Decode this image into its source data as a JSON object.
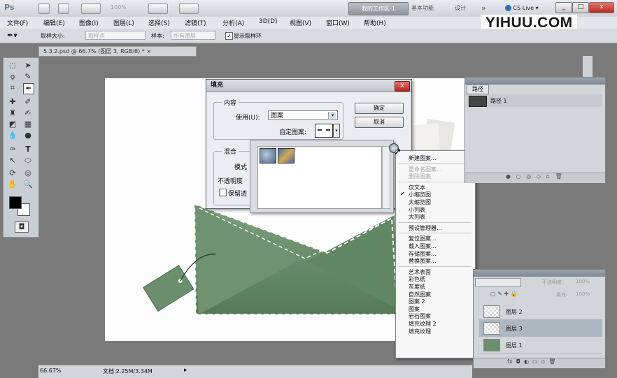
{
  "app": {
    "logo": "Ps",
    "zoom_label": "100%",
    "workspace_active": "我的工作区-1",
    "workspaces": [
      "基本功能",
      "设计"
    ],
    "more": "»",
    "cs_live": "CS Live",
    "window_buttons": [
      "_",
      "□",
      "x"
    ]
  },
  "menu": [
    "文件(F)",
    "编辑(E)",
    "图像(I)",
    "图层(L)",
    "选择(S)",
    "滤镜(T)",
    "分析(A)",
    "3D(D)",
    "视图(V)",
    "窗口(W)",
    "帮助(H)"
  ],
  "watermark": "YIHUU.COM",
  "options": {
    "sample_size_label": "取样大小:",
    "sample_size_value": "取样点",
    "sample_label": "样本:",
    "sample_value": "所有图层",
    "show_ring_label": "显示取样环"
  },
  "document": {
    "tab": "5.3.2.psd @ 66.7% (图层 3, RGB/8) * ×",
    "zoom": "66.67%",
    "doc_info": "文档:2.25M/3.34M"
  },
  "dialog": {
    "title": "填充",
    "close": "x",
    "content_group": "内容",
    "use_label": "使用(U):",
    "use_value": "图案",
    "custom_pattern_label": "自定图案:",
    "blend_group": "混合",
    "mode_label": "模式",
    "opacity_label": "不透明度",
    "preserve_label": "保留透",
    "ok": "确定",
    "cancel": "取消"
  },
  "context_menu": {
    "items": [
      {
        "label": "新建图案...",
        "disabled": false,
        "checked": false
      },
      {
        "sep": true
      },
      {
        "label": "重命名图案...",
        "disabled": true,
        "checked": false
      },
      {
        "label": "删除图案",
        "disabled": true,
        "checked": false
      },
      {
        "sep": true
      },
      {
        "label": "仅文本",
        "disabled": false,
        "checked": false
      },
      {
        "label": "小缩览图",
        "disabled": false,
        "checked": true
      },
      {
        "label": "大缩览图",
        "disabled": false,
        "checked": false
      },
      {
        "label": "小列表",
        "disabled": false,
        "checked": false
      },
      {
        "label": "大列表",
        "disabled": false,
        "checked": false
      },
      {
        "sep": true
      },
      {
        "label": "预设管理器...",
        "disabled": false,
        "checked": false
      },
      {
        "sep": true
      },
      {
        "label": "复位图案...",
        "disabled": false,
        "checked": false
      },
      {
        "label": "载入图案...",
        "disabled": false,
        "checked": false
      },
      {
        "label": "存储图案...",
        "disabled": false,
        "checked": false
      },
      {
        "label": "替换图案...",
        "disabled": false,
        "checked": false
      },
      {
        "sep": true
      },
      {
        "label": "艺术表面",
        "disabled": false,
        "checked": false
      },
      {
        "label": "彩色纸",
        "disabled": false,
        "checked": false
      },
      {
        "label": "灰度纸",
        "disabled": false,
        "checked": false
      },
      {
        "label": "自然图案",
        "disabled": false,
        "checked": false
      },
      {
        "label": "图案 2",
        "disabled": false,
        "checked": false
      },
      {
        "label": "图案",
        "disabled": false,
        "checked": false
      },
      {
        "label": "岩石图案",
        "disabled": false,
        "checked": false
      },
      {
        "label": "填充纹理 2",
        "disabled": false,
        "checked": false
      },
      {
        "label": "填充纹理",
        "disabled": false,
        "checked": false
      }
    ]
  },
  "paths_panel": {
    "title": "路径",
    "path_name": "路径 1"
  },
  "layers_panel": {
    "opacity_label": "不透明度:",
    "opacity_value": "100%",
    "fill_label": "填充:",
    "fill_value": "100%",
    "layers": [
      {
        "name": "图层 2",
        "selected": false
      },
      {
        "name": "图层 3",
        "selected": true
      },
      {
        "name": "图层 1",
        "selected": false
      }
    ]
  },
  "colors": {
    "envelope": "#6b8f6c",
    "selection": "#c9cdd3",
    "close_red": "#c0392b"
  }
}
